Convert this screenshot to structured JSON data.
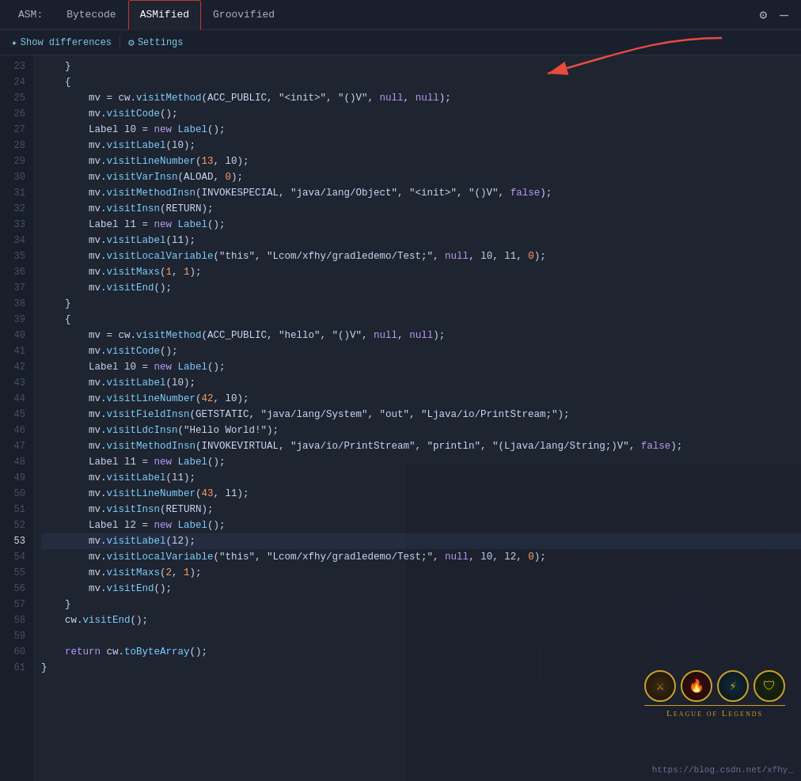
{
  "tabs": [
    {
      "id": "asm",
      "label": "ASM:",
      "active": false
    },
    {
      "id": "bytecode",
      "label": "Bytecode",
      "active": false
    },
    {
      "id": "asmified",
      "label": "ASMified",
      "active": true
    },
    {
      "id": "groovified",
      "label": "Groovified",
      "active": false
    }
  ],
  "toolbar": {
    "show_differences": "Show differences",
    "settings": "Settings"
  },
  "url": "https://blog.csdn.net/xfhy_",
  "lines": [
    {
      "num": 23,
      "content": "    }"
    },
    {
      "num": 24,
      "content": "    {"
    },
    {
      "num": 25,
      "content": "        mv = cw.visitMethod(ACC_PUBLIC, \"<init>\", \"()V\", null, null);"
    },
    {
      "num": 26,
      "content": "        mv.visitCode();"
    },
    {
      "num": 27,
      "content": "        Label l0 = new Label();"
    },
    {
      "num": 28,
      "content": "        mv.visitLabel(l0);"
    },
    {
      "num": 29,
      "content": "        mv.visitLineNumber(13, l0);"
    },
    {
      "num": 30,
      "content": "        mv.visitVarInsn(ALOAD, 0);"
    },
    {
      "num": 31,
      "content": "        mv.visitMethodInsn(INVOKESPECIAL, \"java/lang/Object\", \"<init>\", \"()V\", false);"
    },
    {
      "num": 32,
      "content": "        mv.visitInsn(RETURN);"
    },
    {
      "num": 33,
      "content": "        Label l1 = new Label();"
    },
    {
      "num": 34,
      "content": "        mv.visitLabel(l1);"
    },
    {
      "num": 35,
      "content": "        mv.visitLocalVariable(\"this\", \"Lcom/xfhy/gradledemo/Test;\", null, l0, l1, 0);"
    },
    {
      "num": 36,
      "content": "        mv.visitMaxs(1, 1);"
    },
    {
      "num": 37,
      "content": "        mv.visitEnd();"
    },
    {
      "num": 38,
      "content": "    }"
    },
    {
      "num": 39,
      "content": "    {"
    },
    {
      "num": 40,
      "content": "        mv = cw.visitMethod(ACC_PUBLIC, \"hello\", \"()V\", null, null);"
    },
    {
      "num": 41,
      "content": "        mv.visitCode();"
    },
    {
      "num": 42,
      "content": "        Label l0 = new Label();"
    },
    {
      "num": 43,
      "content": "        mv.visitLabel(l0);"
    },
    {
      "num": 44,
      "content": "        mv.visitLineNumber(42, l0);"
    },
    {
      "num": 45,
      "content": "        mv.visitFieldInsn(GETSTATIC, \"java/lang/System\", \"out\", \"Ljava/io/PrintStream;\");"
    },
    {
      "num": 46,
      "content": "        mv.visitLdcInsn(\"Hello World!\");"
    },
    {
      "num": 47,
      "content": "        mv.visitMethodInsn(INVOKEVIRTUAL, \"java/io/PrintStream\", \"println\", \"(Ljava/lang/String;)V\", false);"
    },
    {
      "num": 48,
      "content": "        Label l1 = new Label();"
    },
    {
      "num": 49,
      "content": "        mv.visitLabel(l1);"
    },
    {
      "num": 50,
      "content": "        mv.visitLineNumber(43, l1);"
    },
    {
      "num": 51,
      "content": "        mv.visitInsn(RETURN);"
    },
    {
      "num": 52,
      "content": "        Label l2 = new Label();"
    },
    {
      "num": 53,
      "content": "        mv.visitLabel(l2);",
      "current": true
    },
    {
      "num": 54,
      "content": "        mv.visitLocalVariable(\"this\", \"Lcom/xfhy/gradledemo/Test;\", null, l0, l2, 0);"
    },
    {
      "num": 55,
      "content": "        mv.visitMaxs(2, 1);"
    },
    {
      "num": 56,
      "content": "        mv.visitEnd();"
    },
    {
      "num": 57,
      "content": "    }"
    },
    {
      "num": 58,
      "content": "    cw.visitEnd();"
    },
    {
      "num": 59,
      "content": ""
    },
    {
      "num": 60,
      "content": "    return cw.toByteArray();"
    },
    {
      "num": 61,
      "content": "}"
    }
  ]
}
